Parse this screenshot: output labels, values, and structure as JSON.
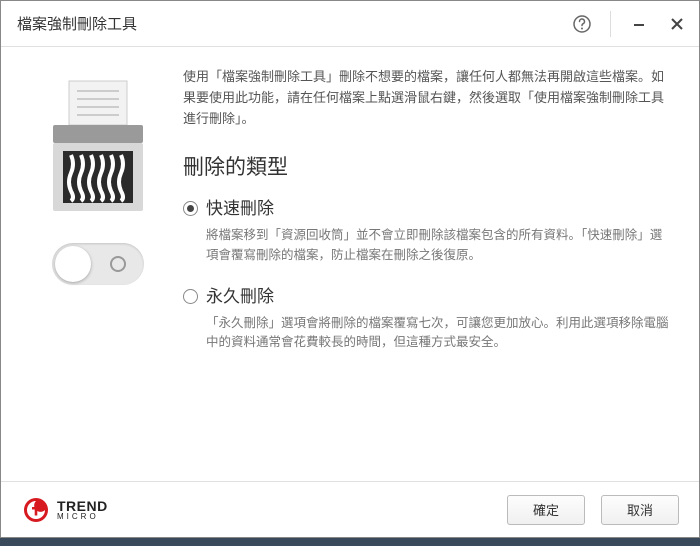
{
  "window": {
    "title": "檔案強制刪除工具"
  },
  "intro": "使用「檔案強制刪除工具」刪除不想要的檔案，讓任何人都無法再開啟這些檔案。如果要使用此功能，請在任何檔案上點選滑鼠右鍵，然後選取「使用檔案強制刪除工具進行刪除」。",
  "section_heading": "刪除的類型",
  "options": [
    {
      "label": "快速刪除",
      "desc": "將檔案移到「資源回收筒」並不會立即刪除該檔案包含的所有資料。「快速刪除」選項會覆寫刪除的檔案，防止檔案在刪除之後復原。",
      "selected": true
    },
    {
      "label": "永久刪除",
      "desc": "「永久刪除」選項會將刪除的檔案覆寫七次，可讓您更加放心。利用此選項移除電腦中的資料通常會花費較長的時間，但這種方式最安全。",
      "selected": false
    }
  ],
  "toggle": {
    "enabled": false
  },
  "buttons": {
    "confirm": "確定",
    "cancel": "取消"
  },
  "brand": {
    "name": "TREND",
    "sub": "MICRO"
  },
  "icons": {
    "help": "help-icon",
    "minimize": "minimize-icon",
    "close": "close-icon",
    "shredder": "shredder-icon",
    "swirl": "trend-swirl-icon"
  }
}
